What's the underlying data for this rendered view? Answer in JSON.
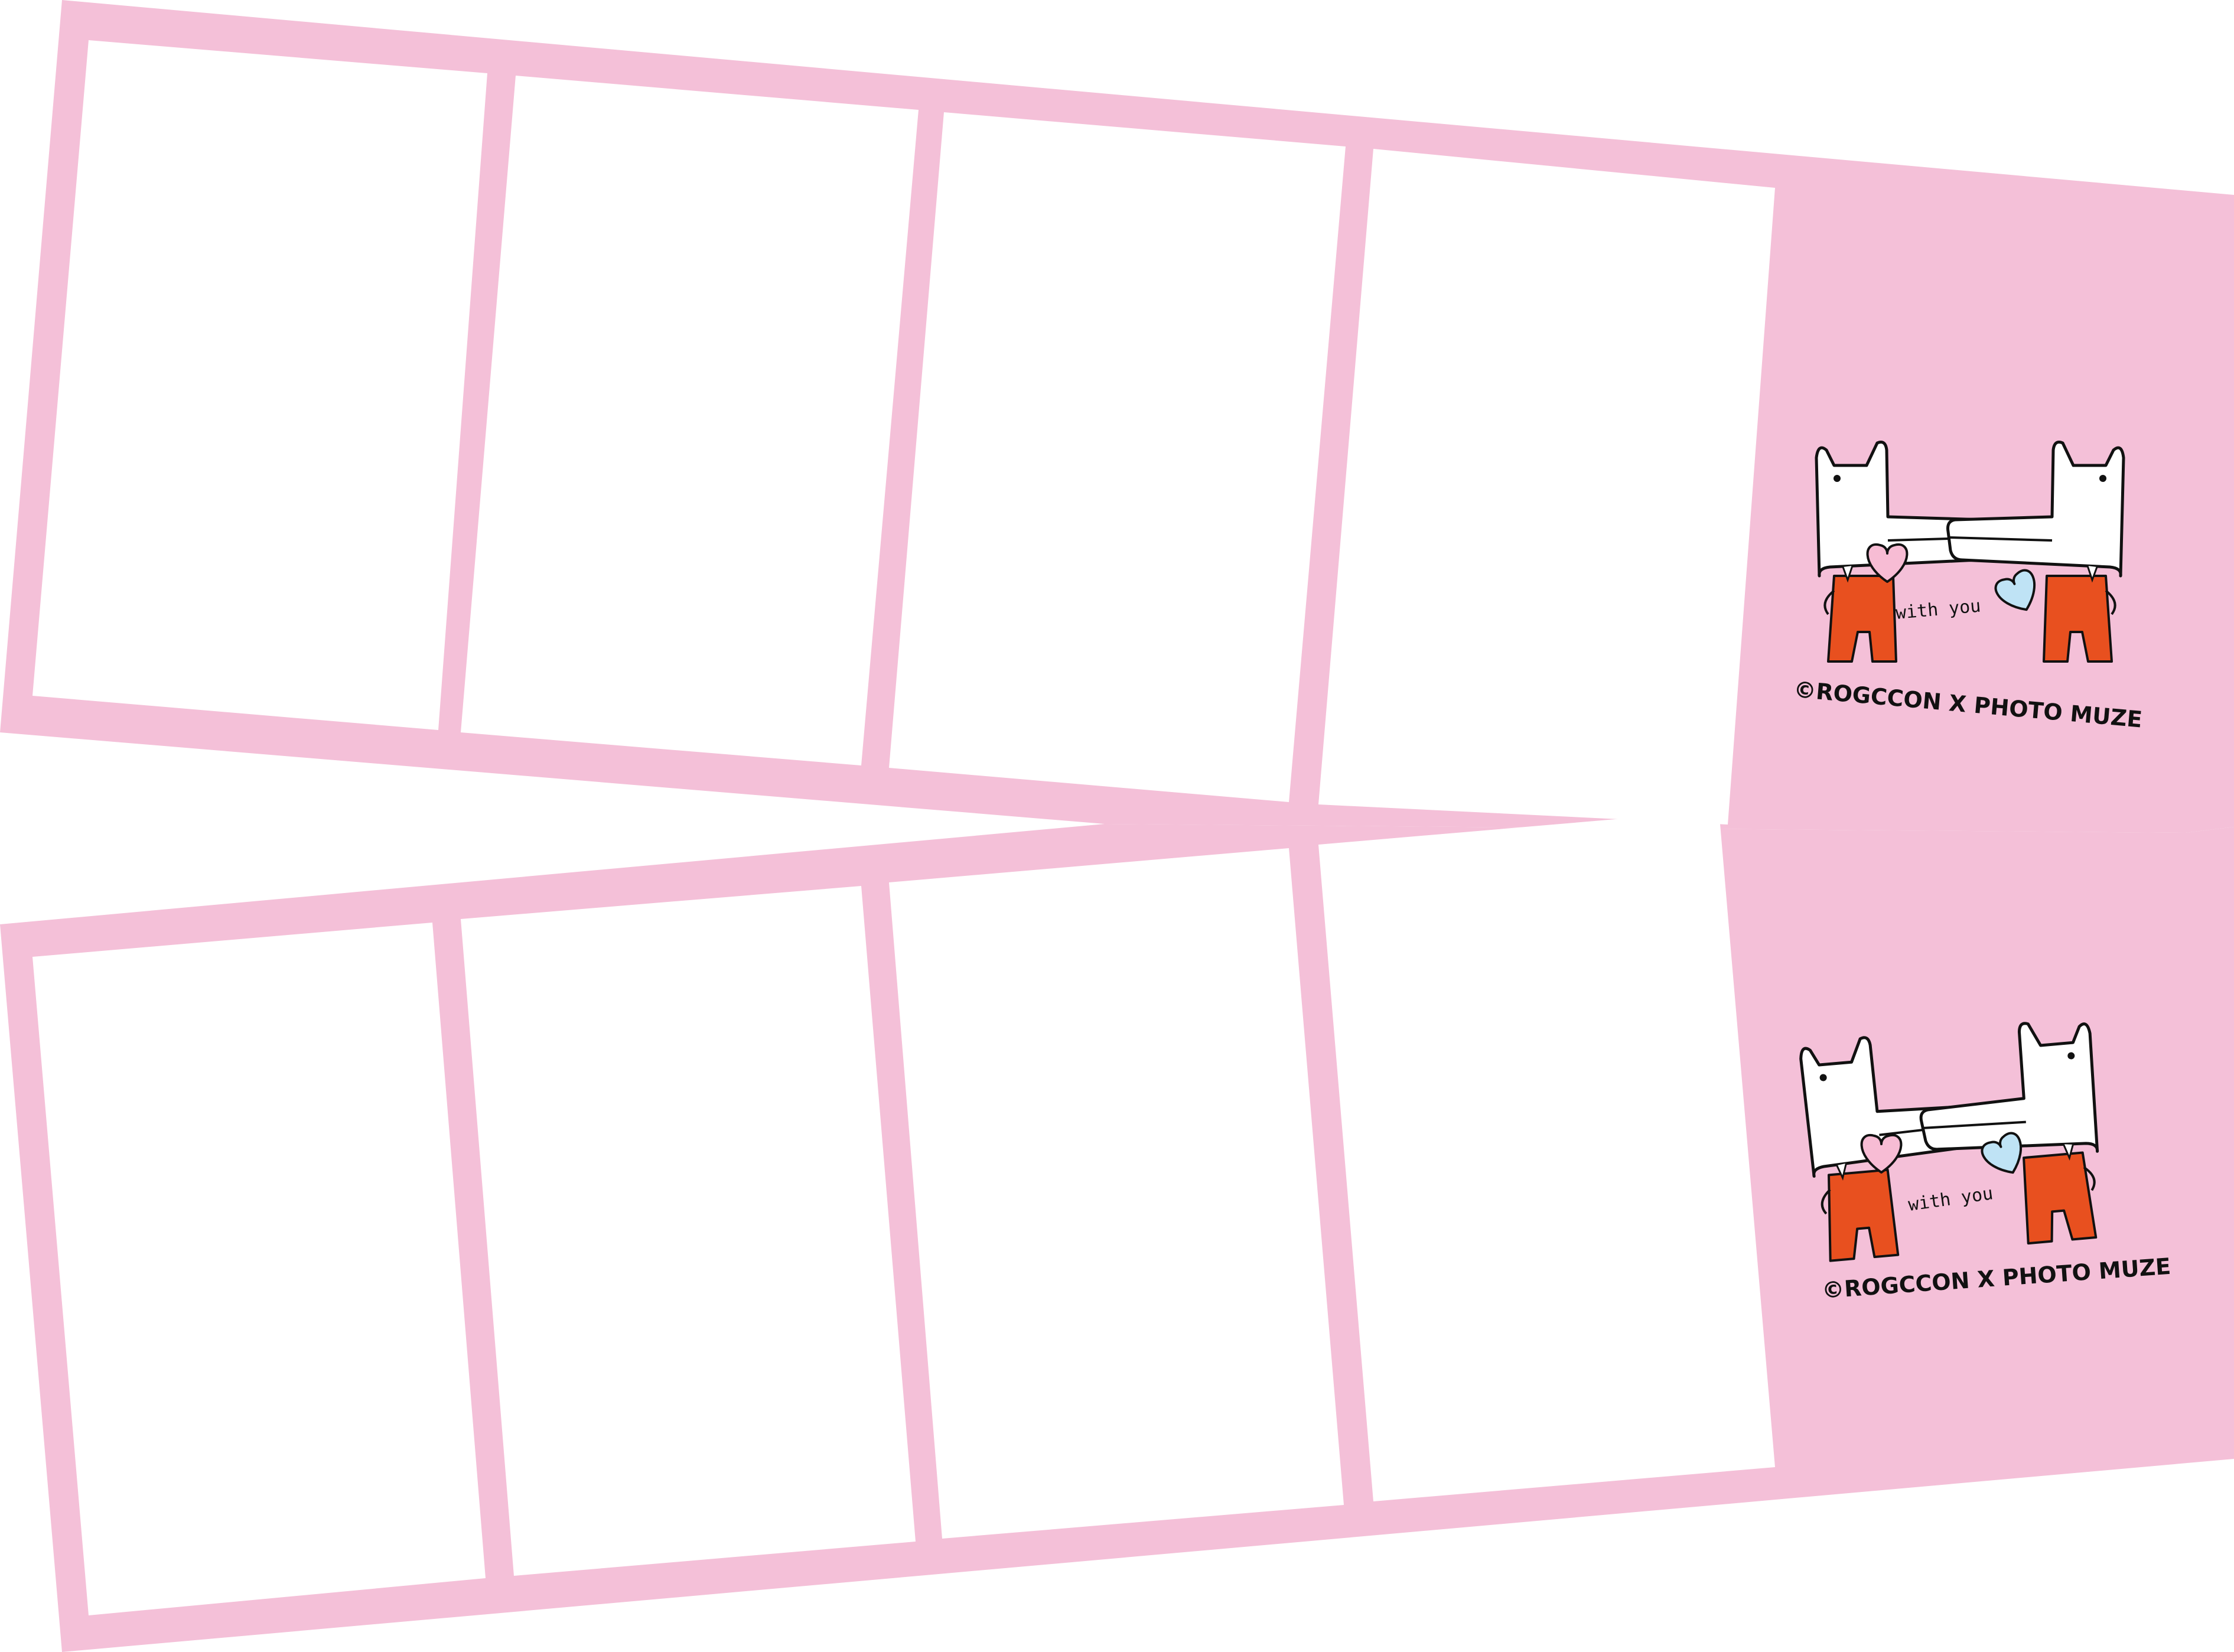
{
  "colors": {
    "frame": "#f4c0d8",
    "photo_slot": "#ffffff",
    "character_body": "#e8501f",
    "character_head": "#ffffff",
    "heart_pink": "#f7bcd4",
    "heart_blue": "#bfe3f5",
    "ink": "#111111"
  },
  "strips": [
    {
      "name": "top-strip",
      "photo_slots": 4,
      "caption": "with you",
      "credit": "©ROGCCON X PHOTO MUZE"
    },
    {
      "name": "bottom-strip",
      "photo_slots": 4,
      "caption": "with you",
      "credit": "©ROGCCON X PHOTO MUZE"
    }
  ],
  "icons": [
    "crocodile-character-icon",
    "heart-icon",
    "copyright-icon"
  ]
}
